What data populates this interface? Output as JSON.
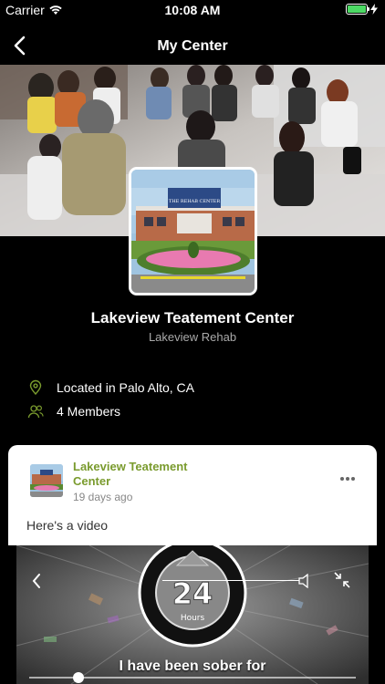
{
  "status_bar": {
    "carrier": "Carrier",
    "time": "10:08 AM",
    "battery_percent": 100
  },
  "nav": {
    "title": "My Center"
  },
  "center": {
    "sign_text": "THE REHAB CENTER",
    "name": "Lakeview Teatement Center",
    "subtitle": "Lakeview Rehab",
    "location": "Located in Palo Alto, CA",
    "members": "4 Members"
  },
  "post": {
    "author": "Lakeview Teatement Center",
    "time_ago": "19 days ago",
    "text": "Here's a video",
    "video": {
      "badge_number": "24",
      "badge_unit": "Hours",
      "caption": "I have been sober for",
      "progress": 0.15
    }
  },
  "colors": {
    "accent": "#7a9b2e",
    "background": "#000000",
    "card": "#ffffff",
    "battery": "#4cd964"
  }
}
